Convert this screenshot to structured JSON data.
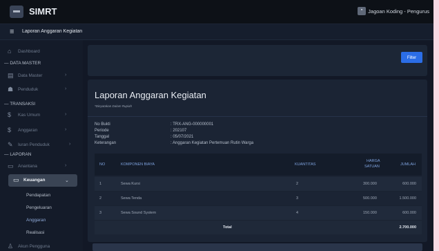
{
  "app": {
    "brand": "SIMRT",
    "user": "Jagoan Koding - Pengurus"
  },
  "subbar": {
    "title": "Laporan Anggaran Kegiatan"
  },
  "sidebar": {
    "items": [
      {
        "label": "Dashboard",
        "icon": "home-icon",
        "chevron": ""
      },
      {
        "section": "DATA MASTER"
      },
      {
        "label": "Data Master",
        "icon": "database-icon",
        "chevron": "›"
      },
      {
        "label": "Penduduk",
        "icon": "users-icon",
        "chevron": "›"
      },
      {
        "section": "TRANSAKSI"
      },
      {
        "label": "Kas Umum",
        "icon": "dollar-icon",
        "chevron": "›"
      },
      {
        "label": "Anggaran",
        "icon": "dollar-icon",
        "chevron": "›"
      },
      {
        "label": "Iuran Penduduk",
        "icon": "edit-icon",
        "chevron": "›"
      },
      {
        "section": "LAPORAN"
      },
      {
        "label": "Anantana",
        "icon": "monitor-icon",
        "chevron": "›"
      },
      {
        "label": "Keuangan",
        "icon": "monitor-icon",
        "chevron": "⌄",
        "active": true
      },
      {
        "label": "Pendapatan",
        "sub": true
      },
      {
        "label": "Pengeluaran",
        "sub": true
      },
      {
        "label": "Anggaran",
        "sub": true,
        "current": true
      },
      {
        "label": "Realisasi",
        "sub": true
      },
      {
        "label": "Akun Pengguna",
        "icon": "user-icon",
        "chevron": ""
      }
    ]
  },
  "filter": {
    "button": "Filter"
  },
  "report": {
    "title": "Laporan Anggaran Kegiatan",
    "note": "*Dinyatakan Dalam Rupiah",
    "info": [
      {
        "label": "No Bukti",
        "value": ": TRX-ANG-000000001"
      },
      {
        "label": "Periode",
        "value": ": 202107"
      },
      {
        "label": "Tanggal",
        "value": ": 05/07/2021"
      },
      {
        "label": "Keterangan",
        "value": ": Anggaran Kegiatan Pertemuan Rutin Warga"
      }
    ],
    "table": {
      "headers": {
        "no": "NO",
        "komponen": "KOMPONEN BIAYA",
        "kuantitas": "KUANTITAS",
        "harga_line1": "HARGA",
        "harga_line2": "SATUAN",
        "jumlah": "JUMLAH"
      },
      "rows": [
        {
          "no": "1",
          "komponen": "Sewa Kursi",
          "kuantitas": "2",
          "harga": "300.000",
          "jumlah": "600.000"
        },
        {
          "no": "2",
          "komponen": "Sewa Tenda",
          "kuantitas": "3",
          "harga": "500.000",
          "jumlah": "1.500.000"
        },
        {
          "no": "3",
          "komponen": "Sewa Sound System",
          "kuantitas": "4",
          "harga": "150.000",
          "jumlah": "600.000"
        }
      ],
      "total_label": "Total",
      "total_value": "2.700.000"
    }
  },
  "colors": {
    "accent": "#2b6de6",
    "bg": "#121826",
    "card": "#1b2434",
    "header_text": "#7ea2de"
  }
}
